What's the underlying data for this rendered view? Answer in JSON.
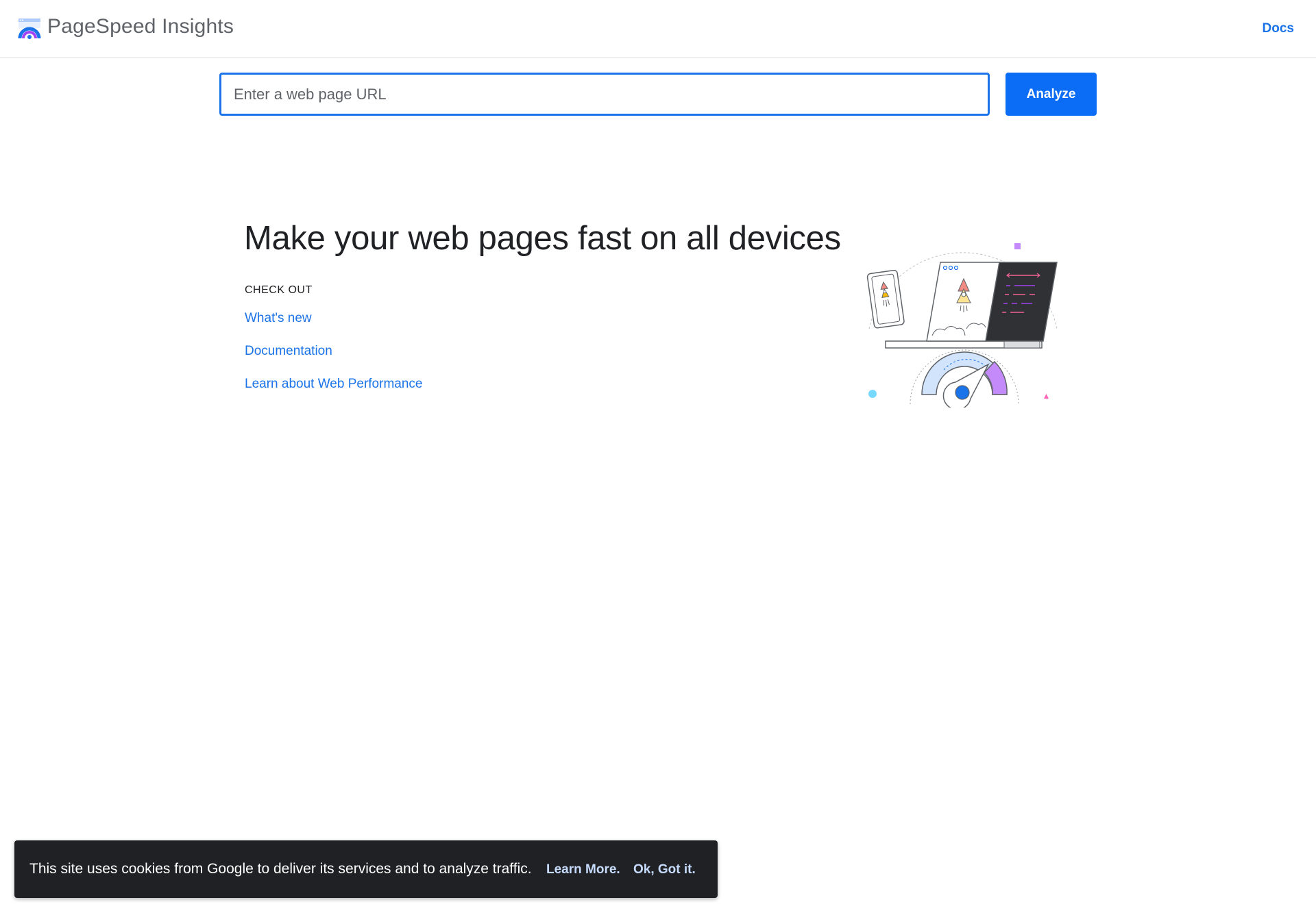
{
  "header": {
    "title": "PageSpeed Insights",
    "logo_icon": "pagespeed-gauge-icon",
    "docs_label": "Docs"
  },
  "search": {
    "placeholder": "Enter a web page URL",
    "value": "",
    "analyze_label": "Analyze"
  },
  "hero": {
    "headline": "Make your web pages fast on all devices",
    "check_out_label": "CHECK OUT",
    "links": [
      {
        "label": "What's new"
      },
      {
        "label": "Documentation"
      },
      {
        "label": "Learn about Web Performance"
      }
    ],
    "illustration_icon": "devices-speed-gauge-illustration"
  },
  "cookie_banner": {
    "message": "This site uses cookies from Google to deliver its services and to analyze traffic.",
    "learn_more_label": "Learn More.",
    "ok_label": "Ok, Got it."
  },
  "colors": {
    "accent": "#1a73e8",
    "button": "#0b6cf5",
    "banner_bg": "#202124"
  }
}
